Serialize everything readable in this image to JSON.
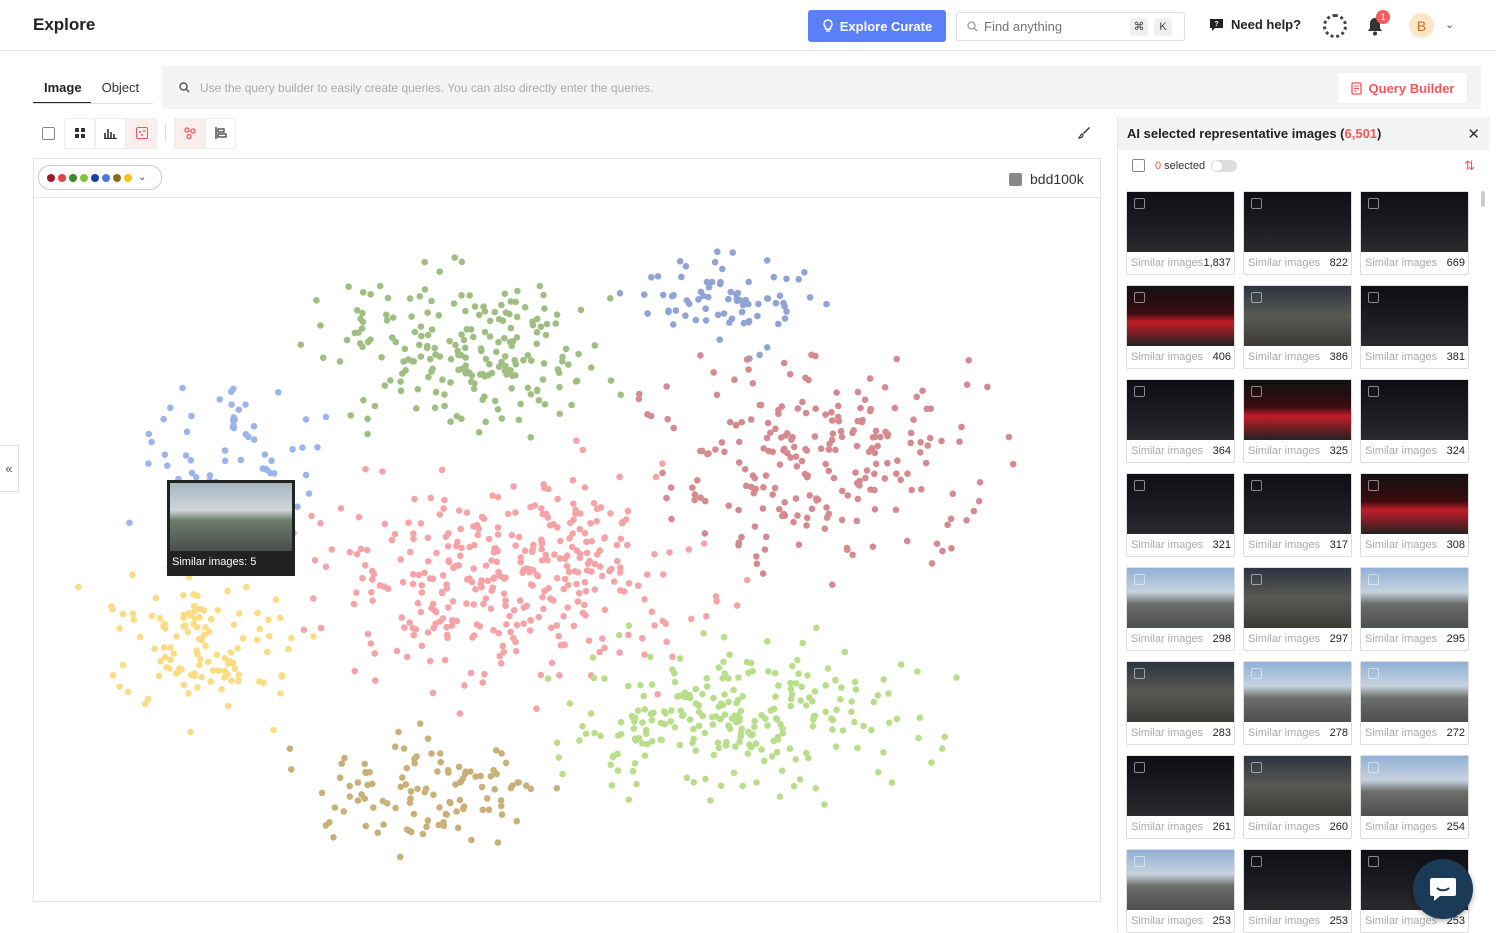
{
  "header": {
    "title": "Explore",
    "curate_label": "Explore Curate",
    "search_placeholder": "Find anything",
    "kbd_cmd": "⌘",
    "kbd_k": "K",
    "help_label": "Need help?",
    "notification_count": "1",
    "avatar_initial": "B"
  },
  "tabs": [
    {
      "label": "Image",
      "active": true
    },
    {
      "label": "Object",
      "active": false
    }
  ],
  "query": {
    "placeholder": "Use the query builder to easily create queries. You can also directly enter the queries.",
    "builder_label": "Query Builder"
  },
  "plot": {
    "dataset_label": "bdd100k",
    "palette": [
      "#9b1d2a",
      "#e8414c",
      "#3c8a2f",
      "#7cc53b",
      "#1c3fa8",
      "#4f78e0",
      "#8a6a1c",
      "#f5c21a"
    ],
    "hover_label": "Similar images: 5"
  },
  "panel": {
    "title_prefix": "AI selected representative images (",
    "count": "6,501",
    "title_suffix": ")",
    "selected_count": "0",
    "selected_label": "selected",
    "similar_label": "Similar images",
    "thumbs": [
      {
        "count": "1,837",
        "tone": "night"
      },
      {
        "count": "822",
        "tone": "night"
      },
      {
        "count": "669",
        "tone": "night"
      },
      {
        "count": "406",
        "tone": "red"
      },
      {
        "count": "386",
        "tone": "dusk"
      },
      {
        "count": "381",
        "tone": "night"
      },
      {
        "count": "364",
        "tone": "night"
      },
      {
        "count": "325",
        "tone": "red"
      },
      {
        "count": "324",
        "tone": "night"
      },
      {
        "count": "321",
        "tone": "night"
      },
      {
        "count": "317",
        "tone": "night"
      },
      {
        "count": "308",
        "tone": "red"
      },
      {
        "count": "298",
        "tone": "day"
      },
      {
        "count": "297",
        "tone": "dusk"
      },
      {
        "count": "295",
        "tone": "day"
      },
      {
        "count": "283",
        "tone": "dusk"
      },
      {
        "count": "278",
        "tone": "day"
      },
      {
        "count": "272",
        "tone": "day"
      },
      {
        "count": "261",
        "tone": "night"
      },
      {
        "count": "260",
        "tone": "dusk"
      },
      {
        "count": "254",
        "tone": "day"
      },
      {
        "count": "253",
        "tone": "day"
      },
      {
        "count": "253",
        "tone": "night"
      },
      {
        "count": "253",
        "tone": "night"
      }
    ]
  }
}
